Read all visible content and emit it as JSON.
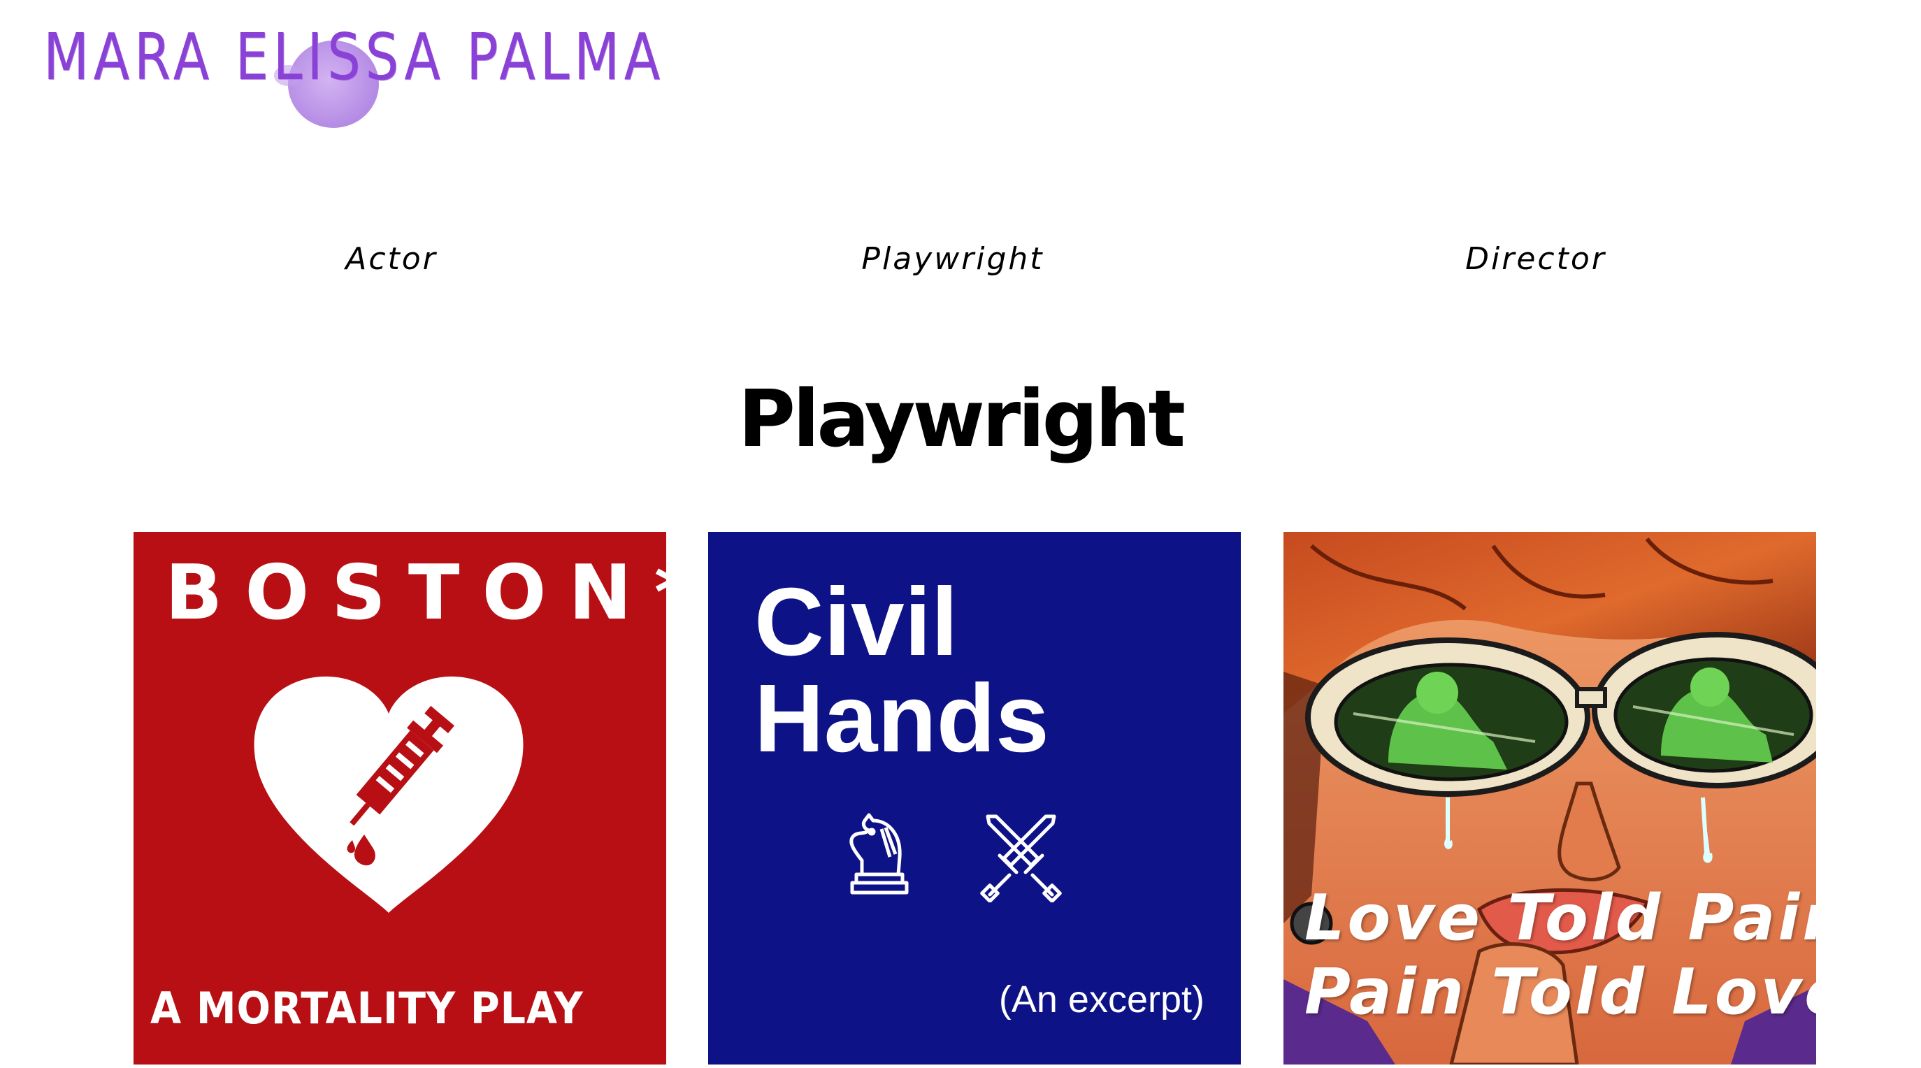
{
  "site": {
    "logo_text": "MARA ELISSA PALMA",
    "logo_color": "#8a42d6"
  },
  "nav": {
    "items": [
      {
        "label": "Actor"
      },
      {
        "label": "Playwright"
      },
      {
        "label": "Director"
      }
    ]
  },
  "page": {
    "title": "Playwright"
  },
  "cards": [
    {
      "title": "BOSTON*:",
      "subtitle": "A MORTALITY PLAY",
      "background": "#b80f14",
      "icon": "heart-syringe-icon"
    },
    {
      "title_line1": "Civil",
      "title_line2": "Hands",
      "note": "(An excerpt)",
      "background": "#0e1287",
      "icons": [
        "chess-knight-icon",
        "crossed-swords-icon"
      ]
    },
    {
      "title_line1": "Love Told Pain,",
      "title_line2": "Pain Told Love",
      "image": "pop-art-woman-sunglasses-crying"
    }
  ]
}
